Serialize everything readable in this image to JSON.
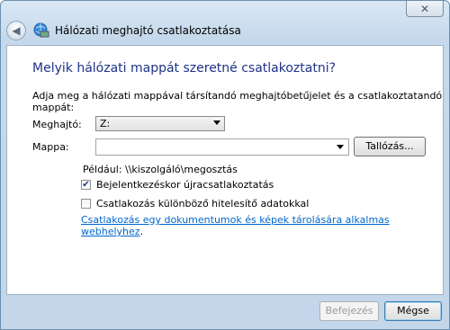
{
  "window": {
    "title": "Hálózati meghajtó csatlakoztatása",
    "close_symbol": "✕"
  },
  "main": {
    "heading": "Melyik hálózati mappát szeretné csatlakoztatni?",
    "intro": "Adja meg a hálózati mappával társítandó meghajtóbetűjelet és a csatlakoztatandó mappát:",
    "drive_label": "Meghajtó:",
    "drive_value": "Z:",
    "folder_label": "Mappa:",
    "folder_value": "",
    "browse_label": "Tallózás...",
    "example": "Például: \\\\kiszolgáló\\megosztás",
    "reconnect_label": "Bejelentkezéskor újracsatlakoztatás",
    "reconnect_checked": true,
    "credentials_label": "Csatlakozás különböző hitelesítő adatokkal",
    "credentials_checked": false,
    "link_text": "Csatlakozás egy dokumentumok és képek tárolására alkalmas webhelyhez",
    "link_suffix": "."
  },
  "footer": {
    "finish_label": "Befejezés",
    "cancel_label": "Mégse"
  },
  "icons": {
    "back": "back-arrow-icon",
    "app": "network-drive-icon",
    "close": "close-icon"
  },
  "colors": {
    "heading": "#1e3287",
    "link": "#0066cc",
    "frame": "#c6d9ec"
  }
}
